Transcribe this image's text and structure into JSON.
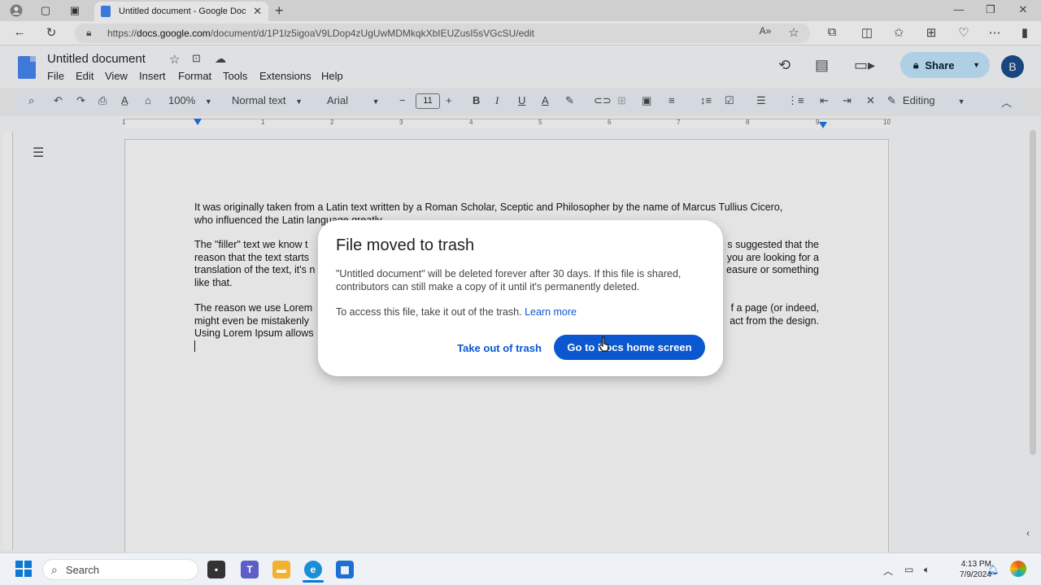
{
  "browser": {
    "tab_title": "Untitled document - Google Doc",
    "url_host": "docs.google.com",
    "url_path": "/document/d/1P1lz5igoaV9LDop4zUgUwMDMkqkXbIEUZusI5sVGcSU/edit"
  },
  "docs": {
    "title": "Untitled document",
    "menu": [
      "File",
      "Edit",
      "View",
      "Insert",
      "Format",
      "Tools",
      "Extensions",
      "Help"
    ],
    "share_label": "Share",
    "avatar_letter": "B"
  },
  "toolbar": {
    "zoom": "100%",
    "style": "Normal text",
    "font": "Arial",
    "font_size": "11",
    "mode": "Editing"
  },
  "ruler_numbers": [
    "1",
    "1",
    "2",
    "3",
    "4",
    "5",
    "6",
    "7",
    "8",
    "9",
    "10"
  ],
  "document": {
    "para1_line1": "It was originally taken from a Latin text written by a Roman Scholar, Sceptic and Philosopher by the name of Marcus Tullius Cicero,",
    "para1_line2": "who influenced the Latin language greatly.",
    "para2_line1_left": "The \"filler\" text we know t",
    "para2_line1_right": "s suggested that the",
    "para2_line2_left": "reason that the text starts",
    "para2_line2_right": "you are looking for a",
    "para2_line3_left": "translation of the text, it's n",
    "para2_line3_right": "easure or something",
    "para2_line4": "like that.",
    "para3_line1_left": "The reason we use Lorem",
    "para3_line1_right": "f a page (or indeed,",
    "para3_line2_left": "might even be mistakenly",
    "para3_line2_right": "act from the design.",
    "para3_line3_left": "Using Lorem Ipsum allows"
  },
  "dialog": {
    "title": "File moved to trash",
    "body": "\"Untitled document\" will be deleted forever after 30 days. If this file is shared, contributors can still make a copy of it until it's permanently deleted.",
    "access_text": "To access this file, take it out of the trash.",
    "learn_more": "Learn more",
    "restore_button": "Take out of trash",
    "home_button": "Go to Docs home screen"
  },
  "taskbar": {
    "search_placeholder": "Search",
    "time": "4:13 PM",
    "date": "7/9/2024"
  },
  "colors": {
    "accent": "#0b57d0",
    "share_bg": "#c2e7ff",
    "docs_blue": "#4285f4"
  }
}
